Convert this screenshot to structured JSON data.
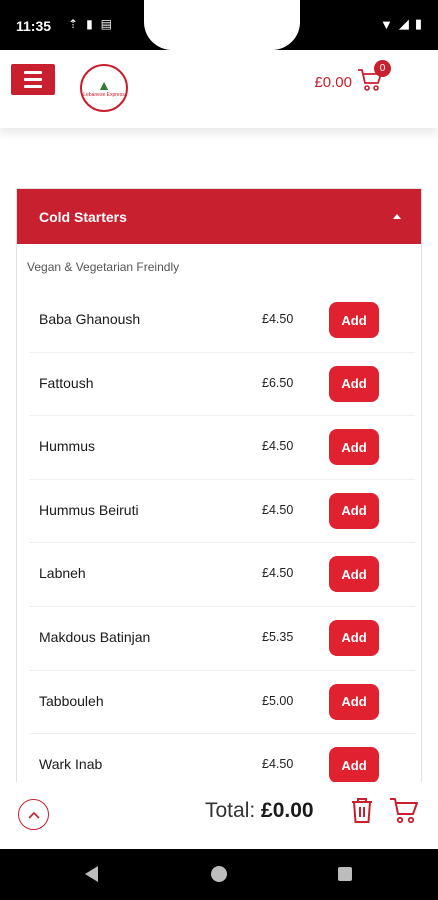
{
  "status_bar": {
    "time": "11:35"
  },
  "header": {
    "logo_text": "Lebanese Express",
    "cart_total": "£0.00",
    "cart_count": "0"
  },
  "section": {
    "title": "Cold Starters",
    "subtitle": "Vegan & Vegetarian Freindly",
    "items": [
      {
        "name": "Baba Ghanoush",
        "price": "£4.50",
        "add_label": "Add"
      },
      {
        "name": "Fattoush",
        "price": "£6.50",
        "add_label": "Add"
      },
      {
        "name": "Hummus",
        "price": "£4.50",
        "add_label": "Add"
      },
      {
        "name": "Hummus Beiruti",
        "price": "£4.50",
        "add_label": "Add"
      },
      {
        "name": "Labneh",
        "price": "£4.50",
        "add_label": "Add"
      },
      {
        "name": "Makdous Batinjan",
        "price": "£5.35",
        "add_label": "Add"
      },
      {
        "name": "Tabbouleh",
        "price": "£5.00",
        "add_label": "Add"
      },
      {
        "name": "Wark Inab",
        "price": "£4.50",
        "add_label": "Add"
      }
    ]
  },
  "footer": {
    "total_label": "Total:",
    "total_value": "£0.00"
  },
  "colors": {
    "brand_red": "#c8202f",
    "button_red": "#e0212f"
  }
}
